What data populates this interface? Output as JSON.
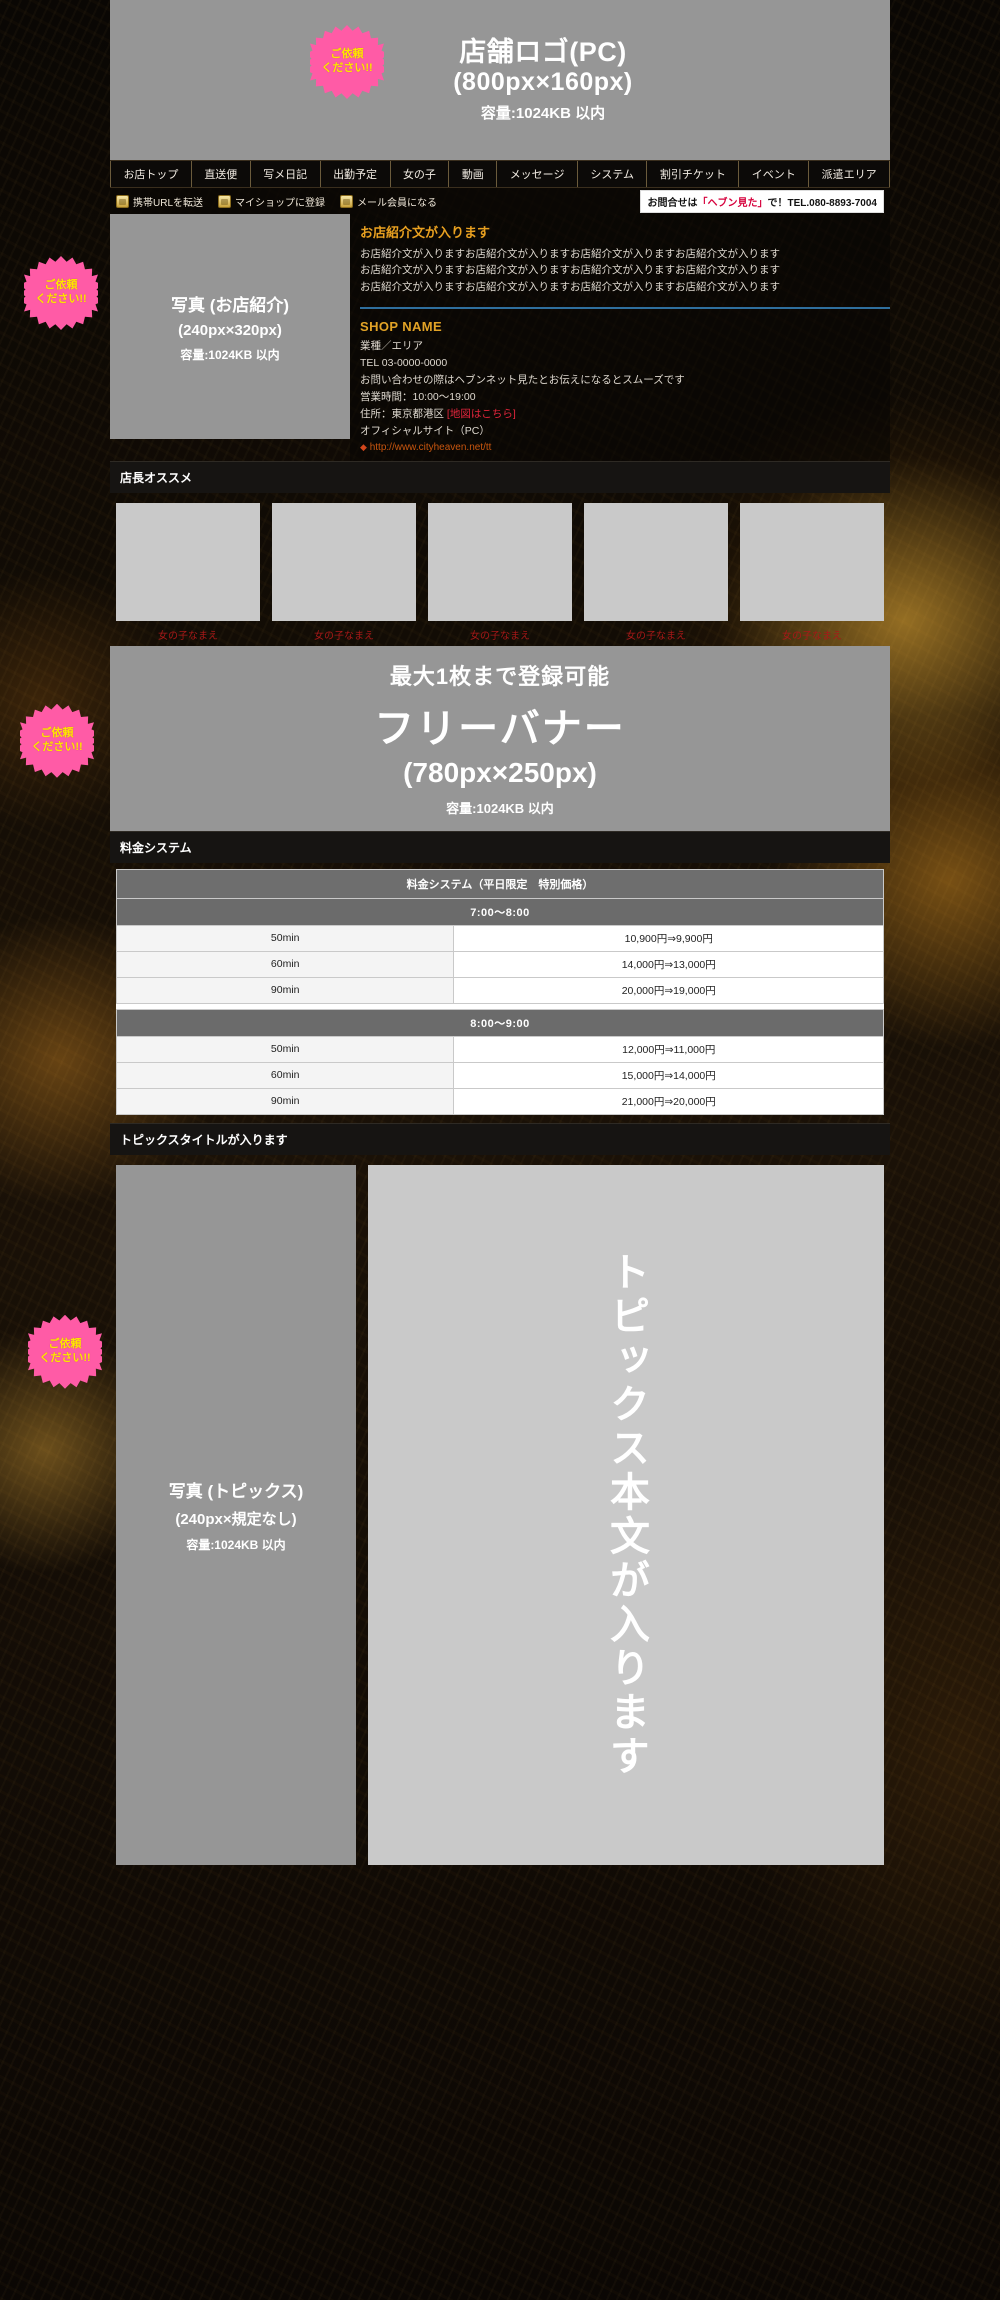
{
  "logo": {
    "line1": "店舗ロゴ(PC)",
    "line2": "(800px×160px)",
    "line3": "容量:1024KB 以内",
    "badge_line1": "ご依頼",
    "badge_line2": "ください!!"
  },
  "nav": {
    "items": [
      {
        "label": "お店トップ"
      },
      {
        "label": "直送便"
      },
      {
        "label": "写メ日記"
      },
      {
        "label": "出勤予定"
      },
      {
        "label": "女の子"
      },
      {
        "label": "動画"
      },
      {
        "label": "メッセージ"
      },
      {
        "label": "システム"
      },
      {
        "label": "割引チケット"
      },
      {
        "label": "イベント"
      },
      {
        "label": "派遣エリア"
      }
    ]
  },
  "util": {
    "links": [
      {
        "label": "携帯URLを転送",
        "icon": "mobile-url-icon"
      },
      {
        "label": "マイショップに登録",
        "icon": "crown-icon"
      },
      {
        "label": "メール会員になる",
        "icon": "mail-icon"
      }
    ],
    "contact_prefix": "お問合せは",
    "contact_highlight": "「ヘブン見た」",
    "contact_suffix": "で！TEL.080-8893-7004"
  },
  "photo": {
    "line1": "写真 (お店紹介)",
    "line2": "(240px×320px)",
    "line3": "容量:1024KB 以内",
    "badge_line1": "ご依頼",
    "badge_line2": "ください!!"
  },
  "intro": {
    "heading": "お店紹介文が入ります",
    "paragraphs": [
      "お店紹介文が入りますお店紹介文が入りますお店紹介文が入りますお店紹介文が入ります",
      "お店紹介文が入りますお店紹介文が入りますお店紹介文が入りますお店紹介文が入ります",
      "お店紹介文が入りますお店紹介文が入りますお店紹介文が入りますお店紹介文が入ります"
    ]
  },
  "shop": {
    "name": "SHOP NAME",
    "category": "業種／エリア",
    "tel": "TEL 03-0000-0000",
    "note": "お問い合わせの際はヘブンネット見たとお伝えになるとスムーズです",
    "hours": "営業時間：10:00～19:00",
    "address_label": "住所：東京都港区",
    "map_link": "[地図はこちら]",
    "official_label": "オフィシャルサイト（PC）",
    "official_url": "http://www.cityheaven.net/tt"
  },
  "recommend": {
    "heading": "店長オススメ",
    "girls": [
      {
        "name": "女の子なまえ"
      },
      {
        "name": "女の子なまえ"
      },
      {
        "name": "女の子なまえ"
      },
      {
        "name": "女の子なまえ"
      },
      {
        "name": "女の子なまえ"
      }
    ]
  },
  "banner": {
    "line1": "最大1枚まで登録可能",
    "line2": "フリーバナー",
    "line3": "(780px×250px)",
    "line4": "容量:1024KB 以内",
    "badge_line1": "ご依頼",
    "badge_line2": "ください!!"
  },
  "price": {
    "heading": "料金システム",
    "table_title": "料金システム（平日限定　特別価格）",
    "groups": [
      {
        "time": "7:00～8:00",
        "rows": [
          {
            "duration": "50min",
            "value": "10,900円⇒9,900円"
          },
          {
            "duration": "60min",
            "value": "14,000円⇒13,000円"
          },
          {
            "duration": "90min",
            "value": "20,000円⇒19,000円"
          }
        ]
      },
      {
        "time": "8:00～9:00",
        "rows": [
          {
            "duration": "50min",
            "value": "12,000円⇒11,000円"
          },
          {
            "duration": "60min",
            "value": "15,000円⇒14,000円"
          },
          {
            "duration": "90min",
            "value": "21,000円⇒20,000円"
          }
        ]
      }
    ]
  },
  "topics": {
    "heading": "トピックスタイトルが入ります",
    "photo_line1": "写真 (トピックス)",
    "photo_line2": "(240px×規定なし)",
    "photo_line3": "容量:1024KB 以内",
    "badge_line1": "ご依頼",
    "badge_line2": "ください!!",
    "body_text": "トピックス本文が入ります"
  },
  "colors": {
    "accent_pink": "#ff5ba6",
    "badge_text": "#ffe400",
    "heading_gold": "#e8a020",
    "map_red": "#e2253c",
    "url_orange": "#c8560f",
    "girl_name_red": "#a71818",
    "placeholder_grey": "#969696"
  }
}
